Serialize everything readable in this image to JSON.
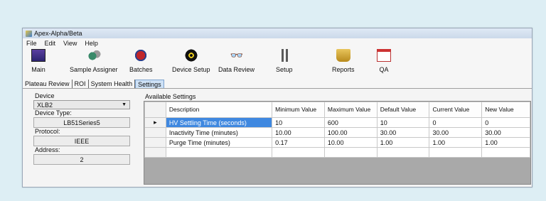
{
  "window": {
    "title": "Apex-Alpha/Beta"
  },
  "menu": [
    "File",
    "Edit",
    "View",
    "Help"
  ],
  "toolbar": [
    {
      "label": "Main",
      "icon": "main-icon"
    },
    {
      "label": "Sample Assigner",
      "icon": "sample-assigner-icon"
    },
    {
      "label": "Batches",
      "icon": "batches-icon"
    },
    {
      "label": "Device Setup",
      "icon": "radiation-icon"
    },
    {
      "label": "Data Review",
      "icon": "binoculars-icon"
    },
    {
      "label": "Setup",
      "icon": "setup-icon"
    },
    {
      "label": "Reports",
      "icon": "reports-icon"
    },
    {
      "label": "QA",
      "icon": "qa-chart-icon"
    }
  ],
  "tabs": [
    "Plateau Review",
    "ROI",
    "System Health",
    "Settings"
  ],
  "active_tab": "Settings",
  "left_panel": {
    "device_label": "Device",
    "device_value": "XLB2",
    "device_type_label": "Device Type:",
    "device_type_value": "LB51Series5",
    "protocol_label": "Protocol:",
    "protocol_value": "IEEE",
    "address_label": "Address:",
    "address_value": "2"
  },
  "settings": {
    "title": "Available Settings",
    "columns": [
      "Description",
      "Minimum Value",
      "Maximum Value",
      "Default Value",
      "Current Value",
      "New Value"
    ],
    "rows": [
      [
        "HV Settling Time (seconds)",
        "10",
        "600",
        "10",
        "0",
        "0"
      ],
      [
        "Inactivity Time (minutes)",
        "10.00",
        "100.00",
        "30.00",
        "30.00",
        "30.00"
      ],
      [
        "Purge Time (minutes)",
        "0.17",
        "10.00",
        "1.00",
        "1.00",
        "1.00"
      ]
    ]
  },
  "colors": {
    "selection": "#3f88e0",
    "background": "#ddeef4",
    "active_tab": "#cde1f6"
  }
}
